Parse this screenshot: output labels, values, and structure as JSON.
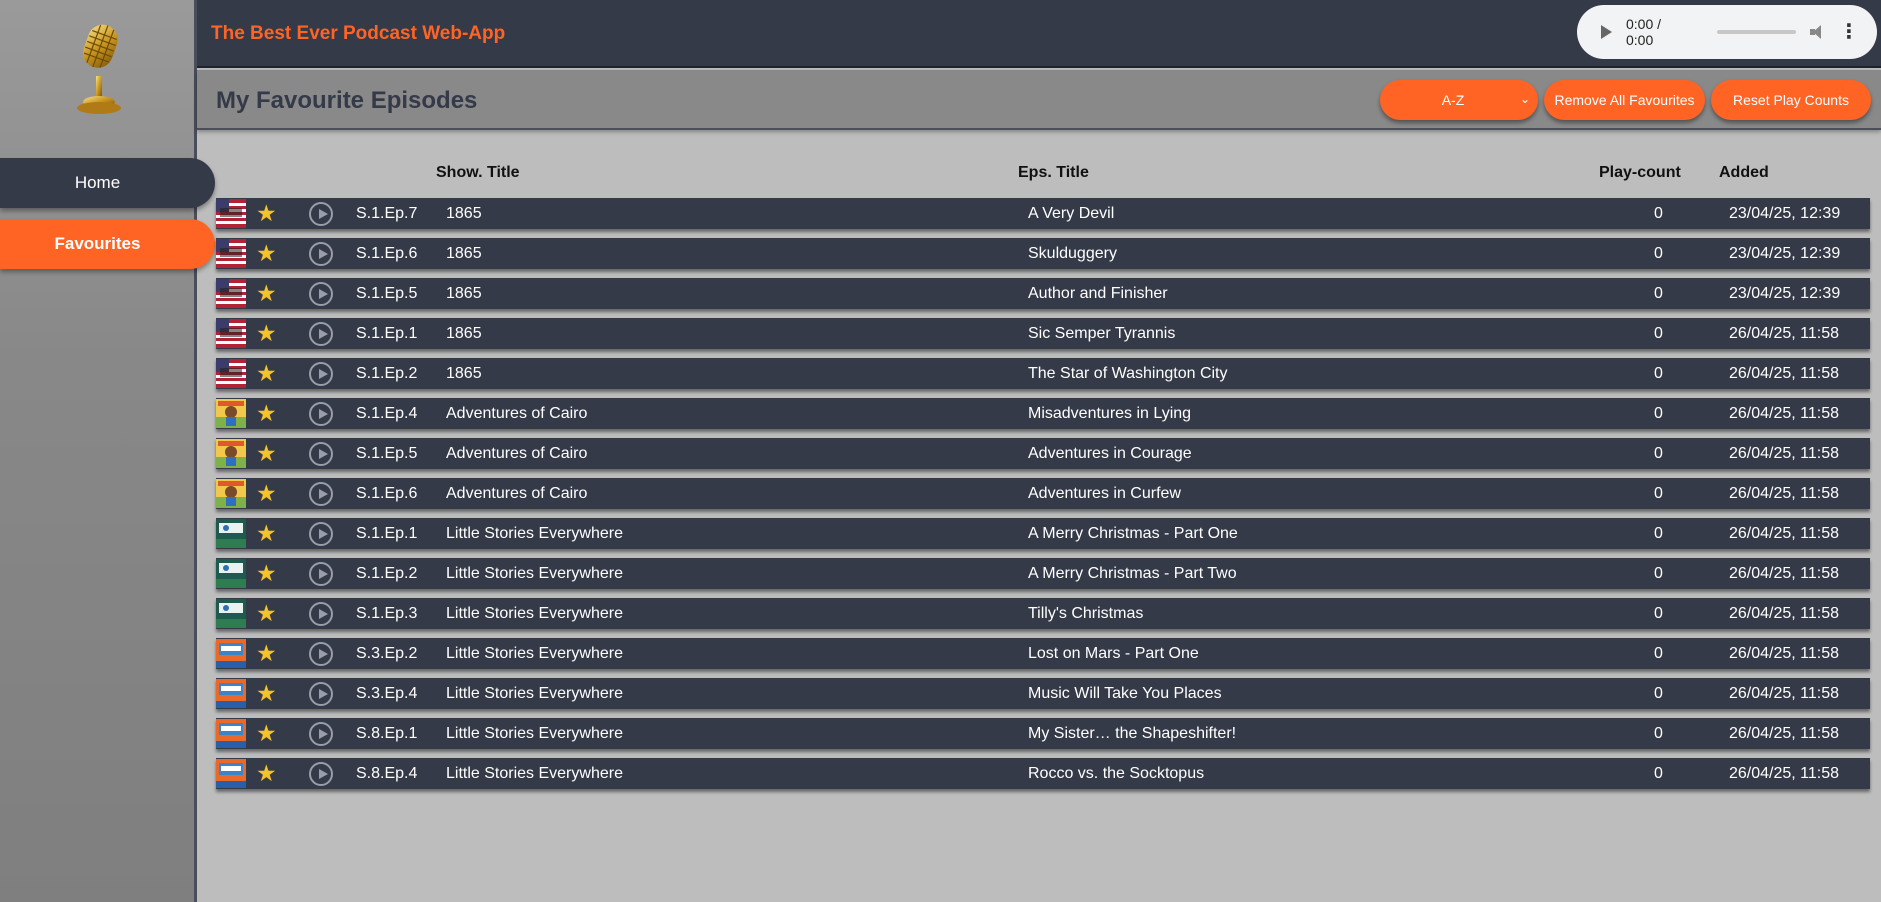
{
  "app": {
    "title": "The Best Ever Podcast Web-App"
  },
  "nav": {
    "home": "Home",
    "favourites": "Favourites"
  },
  "player": {
    "time": "0:00 / 0:00"
  },
  "page": {
    "title": "My Favourite Episodes"
  },
  "controls": {
    "sort_selected": "A-Z",
    "remove_all": "Remove All Favourites",
    "reset_counts": "Reset Play Counts"
  },
  "columns": {
    "show": "Show. Title",
    "episode": "Eps. Title",
    "playcount": "Play-count",
    "added": "Added"
  },
  "episodes": [
    {
      "code": "S.1.Ep.7",
      "show": "1865",
      "title": "A Very Devil",
      "count": "0",
      "added": "23/04/25, 12:39",
      "art": "flag"
    },
    {
      "code": "S.1.Ep.6",
      "show": "1865",
      "title": "Skulduggery",
      "count": "0",
      "added": "23/04/25, 12:39",
      "art": "flag"
    },
    {
      "code": "S.1.Ep.5",
      "show": "1865",
      "title": "Author and Finisher",
      "count": "0",
      "added": "23/04/25, 12:39",
      "art": "flag"
    },
    {
      "code": "S.1.Ep.1",
      "show": "1865",
      "title": "Sic Semper Tyrannis",
      "count": "0",
      "added": "26/04/25, 11:58",
      "art": "flag"
    },
    {
      "code": "S.1.Ep.2",
      "show": "1865",
      "title": "The Star of Washington City",
      "count": "0",
      "added": "26/04/25, 11:58",
      "art": "flag"
    },
    {
      "code": "S.1.Ep.4",
      "show": "Adventures of Cairo",
      "title": "Misadventures in Lying",
      "count": "0",
      "added": "26/04/25, 11:58",
      "art": "cairo"
    },
    {
      "code": "S.1.Ep.5",
      "show": "Adventures of Cairo",
      "title": "Adventures in Courage",
      "count": "0",
      "added": "26/04/25, 11:58",
      "art": "cairo"
    },
    {
      "code": "S.1.Ep.6",
      "show": "Adventures of Cairo",
      "title": "Adventures in Curfew",
      "count": "0",
      "added": "26/04/25, 11:58",
      "art": "cairo"
    },
    {
      "code": "S.1.Ep.1",
      "show": "Little Stories Everywhere",
      "title": "A Merry Christmas - Part One",
      "count": "0",
      "added": "26/04/25, 11:58",
      "art": "lse-green"
    },
    {
      "code": "S.1.Ep.2",
      "show": "Little Stories Everywhere",
      "title": "A Merry Christmas - Part Two",
      "count": "0",
      "added": "26/04/25, 11:58",
      "art": "lse-green"
    },
    {
      "code": "S.1.Ep.3",
      "show": "Little Stories Everywhere",
      "title": "Tilly's Christmas",
      "count": "0",
      "added": "26/04/25, 11:58",
      "art": "lse-green"
    },
    {
      "code": "S.3.Ep.2",
      "show": "Little Stories Everywhere",
      "title": "Lost on Mars - Part One",
      "count": "0",
      "added": "26/04/25, 11:58",
      "art": "lse-orange"
    },
    {
      "code": "S.3.Ep.4",
      "show": "Little Stories Everywhere",
      "title": "Music Will Take You Places",
      "count": "0",
      "added": "26/04/25, 11:58",
      "art": "lse-orange"
    },
    {
      "code": "S.8.Ep.1",
      "show": "Little Stories Everywhere",
      "title": "My Sister… the Shapeshifter!",
      "count": "0",
      "added": "26/04/25, 11:58",
      "art": "lse-orange"
    },
    {
      "code": "S.8.Ep.4",
      "show": "Little Stories Everywhere",
      "title": "Rocco vs. the Socktopus",
      "count": "0",
      "added": "26/04/25, 11:58",
      "art": "lse-orange"
    }
  ],
  "colors": {
    "accent": "#ff6424",
    "dark": "#353a48",
    "star": "#f3c42a"
  }
}
